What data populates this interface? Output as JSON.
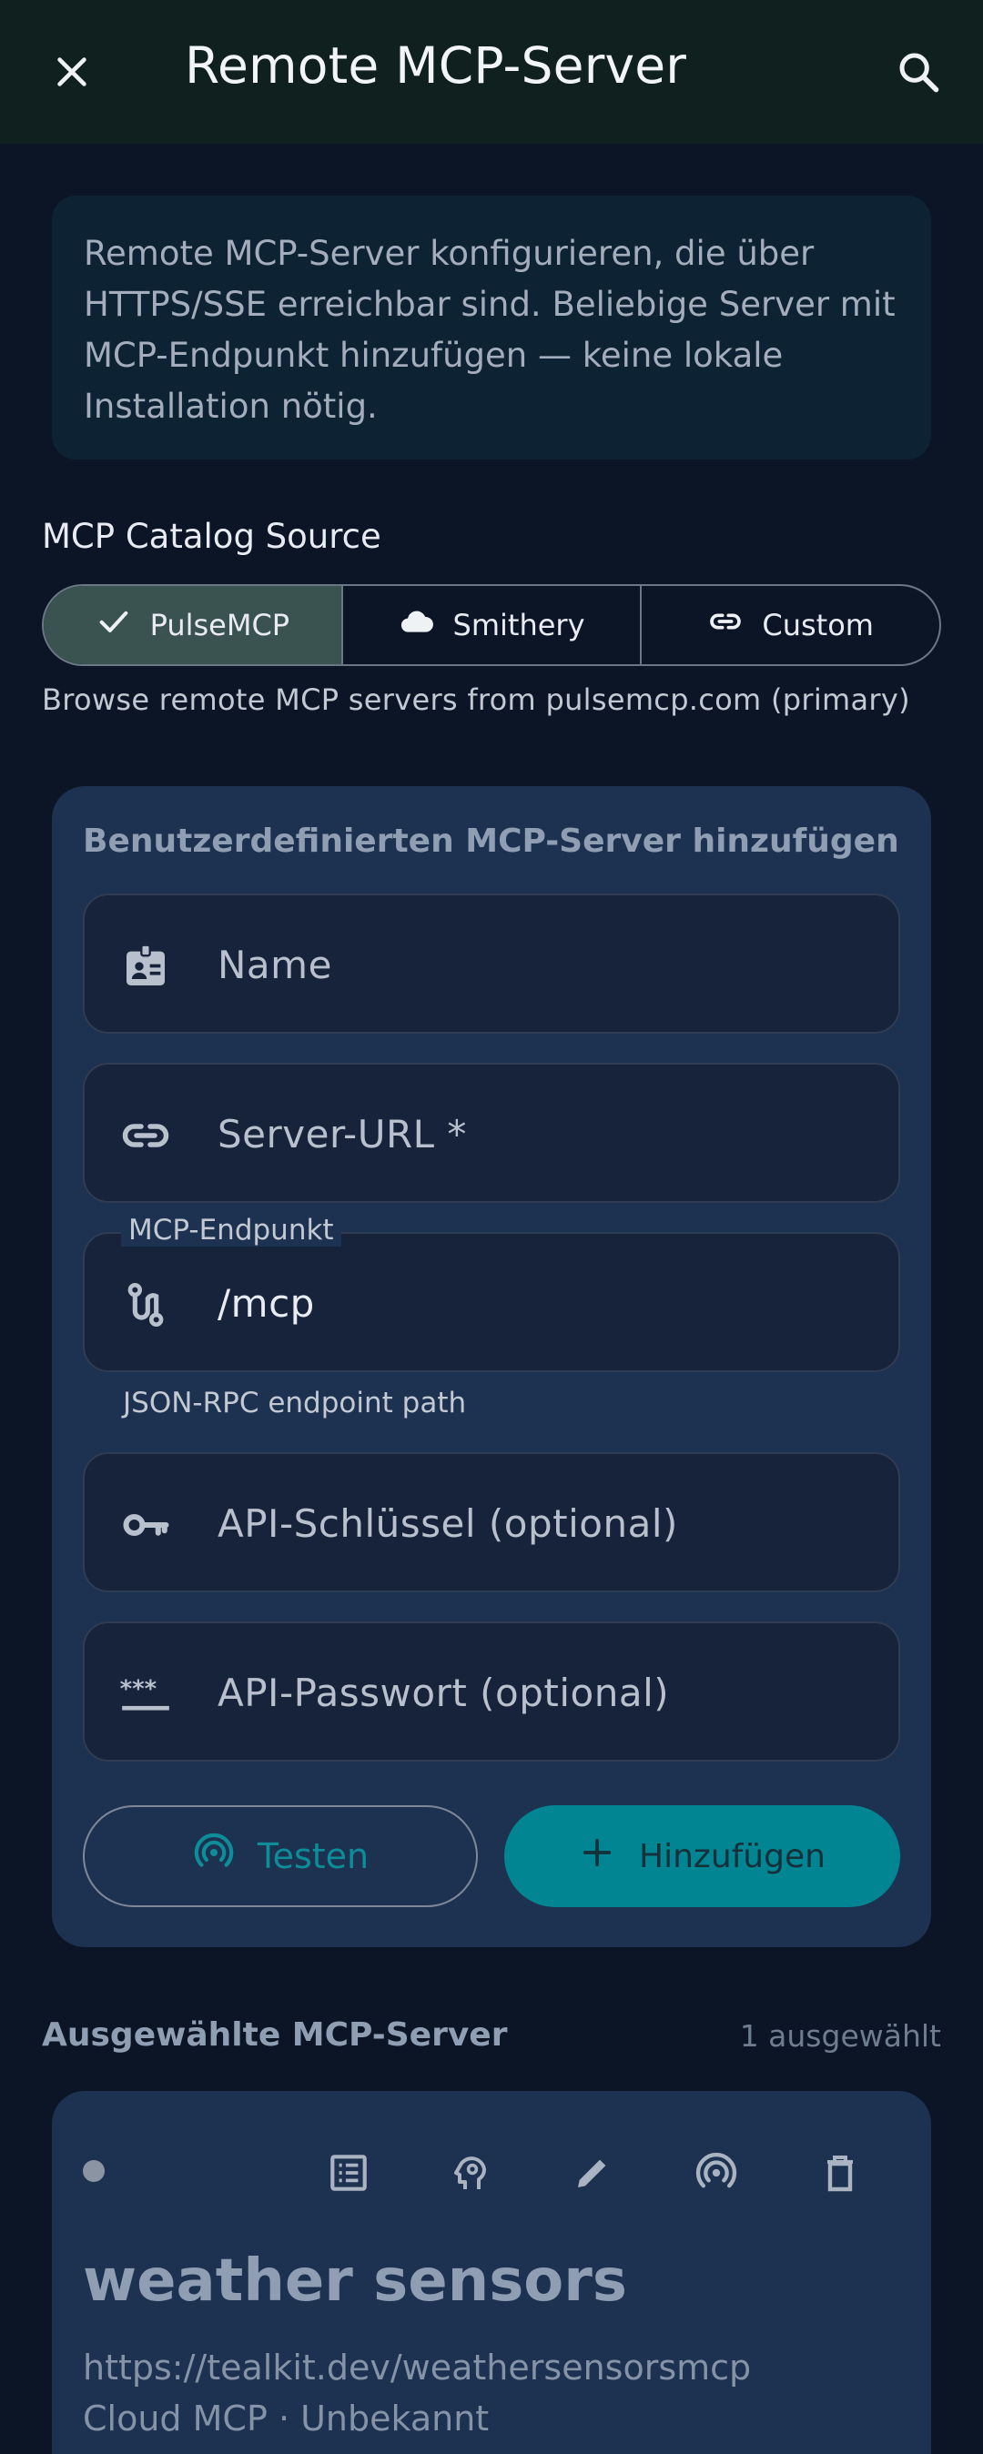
{
  "appbar": {
    "title": "Remote MCP-Server",
    "close_icon": "close-icon",
    "search_icon": "search-icon"
  },
  "info": {
    "text": "Remote MCP-Server konfigurieren, die über HTTPS/SSE erreichbar sind. Beliebige Server mit MCP-Endpunkt hinzufügen — keine lokale Installation nötig."
  },
  "catalog": {
    "label": "MCP Catalog Source",
    "options": [
      {
        "label": "PulseMCP",
        "icon": "check-icon",
        "selected": true
      },
      {
        "label": "Smithery",
        "icon": "cloud-icon",
        "selected": false
      },
      {
        "label": "Custom",
        "icon": "link-icon",
        "selected": false
      }
    ],
    "description": "Browse remote MCP servers from pulsemcp.com (primary)"
  },
  "form": {
    "title": "Benutzerdefinierten MCP-Server hinzufügen",
    "name_placeholder": "Name",
    "url_placeholder": "Server-URL *",
    "endpoint_label": "MCP-Endpunkt",
    "endpoint_value": "/mcp",
    "endpoint_helper": "JSON-RPC endpoint path",
    "api_key_placeholder": "API-Schlüssel (optional)",
    "api_password_placeholder": "API-Passwort (optional)",
    "test_label": "Testen",
    "add_label": "Hinzufügen"
  },
  "selected": {
    "label": "Ausgewählte MCP-Server",
    "count": "1 ausgewählt",
    "servers": [
      {
        "name": "weather sensors",
        "url": "https://tealkit.dev/weathersensorsmcp",
        "meta": "Cloud MCP · Unbekannt"
      }
    ]
  },
  "colors": {
    "background": "#0b1526",
    "appbar": "#10201f",
    "card": "#1d3150",
    "accent": "#028593",
    "selected_segment": "#3a5350"
  }
}
